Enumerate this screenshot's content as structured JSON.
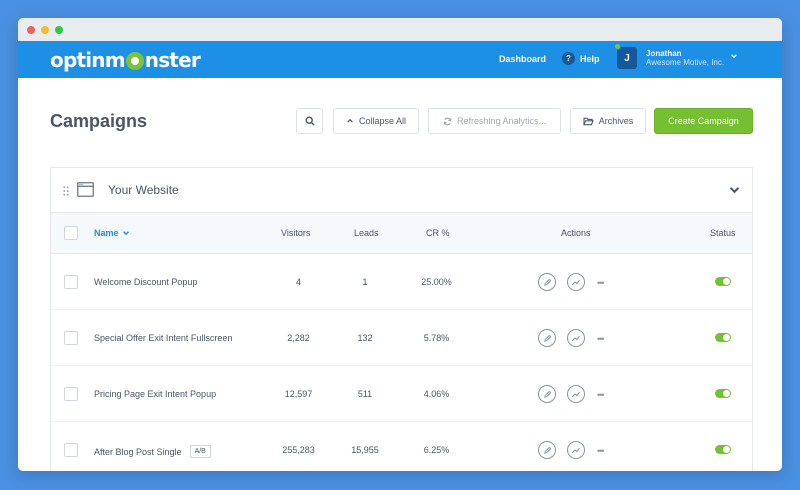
{
  "window": {
    "controls": [
      "close",
      "minimize",
      "maximize"
    ]
  },
  "nav": {
    "logo_parts": [
      "optinm",
      "nster"
    ],
    "dashboard": "Dashboard",
    "help": "Help",
    "help_icon_glyph": "?",
    "user": {
      "initial": "J",
      "name": "Jonathan",
      "company": "Awesome Motive, Inc."
    }
  },
  "toolbar": {
    "title": "Campaigns",
    "collapse": "Collapse All",
    "refresh": "Refreshing Analytics...",
    "archives": "Archives",
    "create": "Create Campaign"
  },
  "panel": {
    "title": "Your Website",
    "columns": {
      "name": "Name",
      "visitors": "Visitors",
      "leads": "Leads",
      "cr": "CR %",
      "actions": "Actions",
      "status": "Status"
    },
    "rows": [
      {
        "name": "Welcome Discount Popup",
        "visitors": "4",
        "leads": "1",
        "cr": "25.00%",
        "badge": null,
        "status_on": true
      },
      {
        "name": "Special Offer Exit Intent Fullscreen",
        "visitors": "2,282",
        "leads": "132",
        "cr": "5.78%",
        "badge": null,
        "status_on": true
      },
      {
        "name": "Pricing Page Exit Intent Popup",
        "visitors": "12,597",
        "leads": "511",
        "cr": "4.06%",
        "badge": null,
        "status_on": true
      },
      {
        "name": "After Blog Post Single",
        "visitors": "255,283",
        "leads": "15,955",
        "cr": "6.25%",
        "badge": "A/B",
        "status_on": true
      }
    ],
    "more_glyph": "•••"
  },
  "colors": {
    "nav": "#1d8fe4",
    "accent_green": "#75c030",
    "link_blue": "#1d8fe4",
    "background": "#4a90e2"
  }
}
